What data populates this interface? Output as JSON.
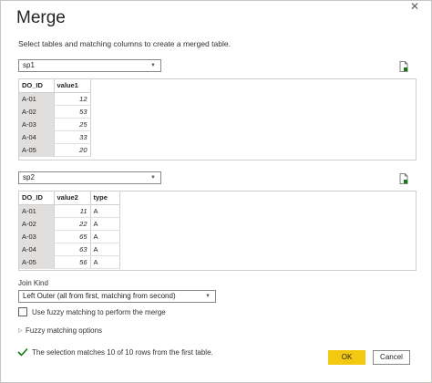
{
  "dialog": {
    "title": "Merge",
    "subtitle": "Select tables and matching columns to create a merged table.",
    "close_glyph": "✕"
  },
  "table1": {
    "selected": "sp1",
    "columns": [
      "DO_ID",
      "value1"
    ],
    "rows": [
      [
        "A-01",
        "12"
      ],
      [
        "A-02",
        "53"
      ],
      [
        "A-03",
        "25"
      ],
      [
        "A-04",
        "33"
      ],
      [
        "A-05",
        "20"
      ]
    ]
  },
  "table2": {
    "selected": "sp2",
    "columns": [
      "DO_ID",
      "value2",
      "type"
    ],
    "rows": [
      [
        "A-01",
        "11",
        "A"
      ],
      [
        "A-02",
        "22",
        "A"
      ],
      [
        "A-03",
        "65",
        "A"
      ],
      [
        "A-04",
        "63",
        "A"
      ],
      [
        "A-05",
        "56",
        "A"
      ]
    ]
  },
  "join": {
    "label": "Join Kind",
    "selected": "Left Outer (all from first, matching from second)"
  },
  "fuzzy": {
    "checkbox_label": "Use fuzzy matching to perform the merge",
    "options_label": "Fuzzy matching options"
  },
  "status": {
    "text": "The selection matches 10 of 10 rows from the first table.",
    "icon": "check-icon",
    "color": "#107c10"
  },
  "buttons": {
    "ok": "OK",
    "cancel": "Cancel",
    "ok_color": "#f2c811"
  }
}
